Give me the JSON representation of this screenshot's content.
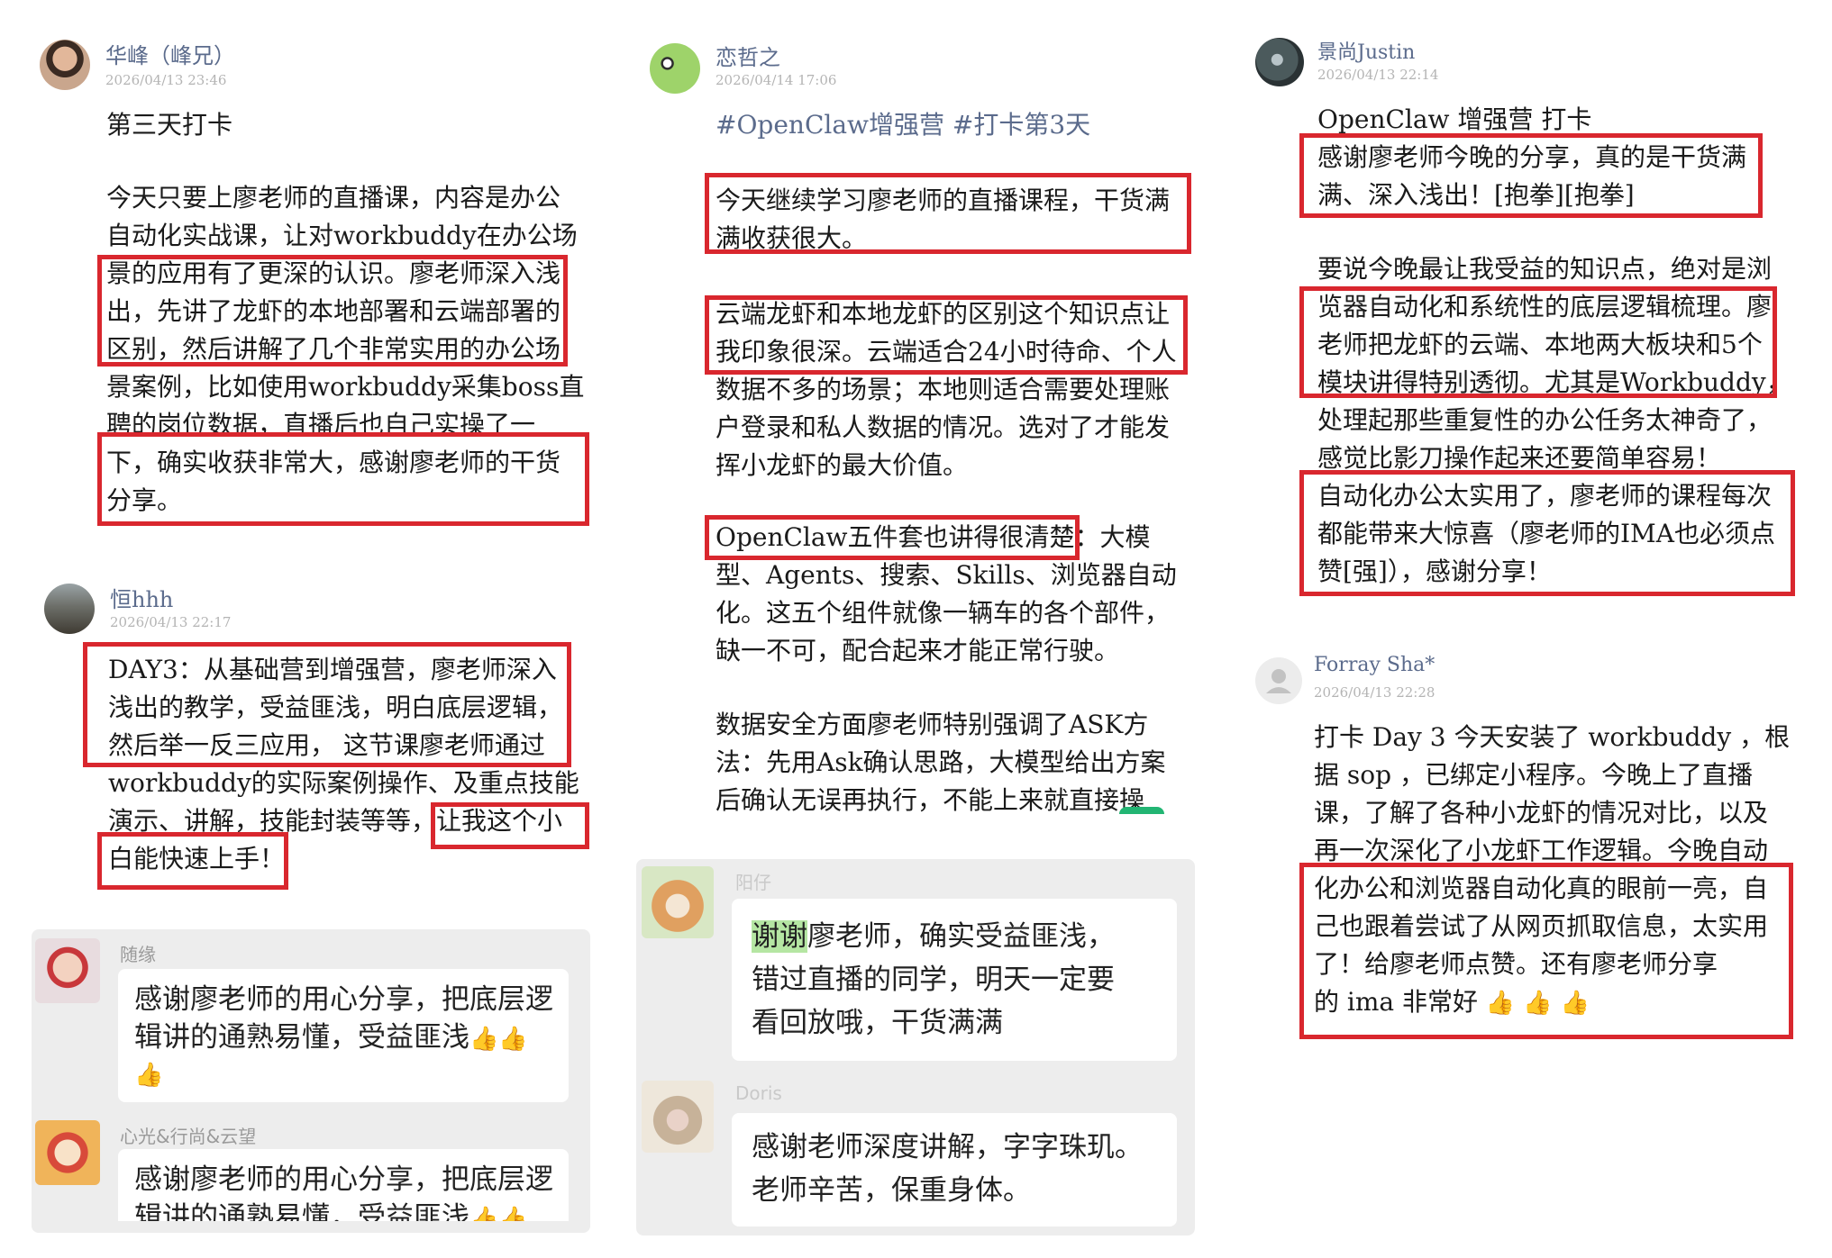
{
  "col1": {
    "post1": {
      "name": "华峰（峰兄）",
      "time": "2026/04/13 23:46",
      "lines": [
        "第三天打卡",
        "今天只要上廖老师的直播课，内容是办公",
        "自动化实战课，让对workbuddy在办公场",
        "景的应用有了更深的认识。廖老师深入浅",
        "出，先讲了龙虾的本地部署和云端部署的",
        "区别，然后讲解了几个非常实用的办公场",
        "景案例，比如使用workbuddy采集boss直",
        "聘的岗位数据，直播后也自己实操了一",
        "下，确实收获非常大，感谢廖老师的干货",
        "分享。"
      ]
    },
    "post2": {
      "name": "恒hhh",
      "time": "2026/04/13 22:17",
      "lines": [
        "DAY3：从基础营到增强营，廖老师深入",
        "浅出的教学，受益匪浅，明白底层逻辑，",
        "然后举一反三应用， 这节课廖老师通过",
        "workbuddy的实际案例操作、及重点技能",
        "演示、讲解，技能封装等等，让我这个小",
        "白能快速上手！"
      ]
    },
    "chat": [
      {
        "name": "随缘",
        "lines": [
          "感谢廖老师的用心分享，把底层逻",
          "辑讲的通熟易懂，受益匪浅"
        ]
      },
      {
        "name": "心光&行尚&云望",
        "lines": [
          "感谢廖老师的用心分享，把底层逻",
          "辑讲的通熟易懂，受益匪浅"
        ]
      }
    ]
  },
  "col2": {
    "post1": {
      "name": "恋哲之",
      "time": "2026/04/14 17:06",
      "hashtag": "#OpenClaw增强营 #打卡第3天",
      "lines": [
        "今天继续学习廖老师的直播课程，干货满",
        "满收获很大。",
        "云端龙虾和本地龙虾的区别这个知识点让",
        "我印象很深。云端适合24小时待命、个人",
        "数据不多的场景；本地则适合需要处理账",
        "户登录和私人数据的情况。选对了才能发",
        "挥小龙虾的最大价值。",
        "OpenClaw五件套也讲得很清楚：大模",
        "型、Agents、搜索、Skills、浏览器自动",
        "化。这五个组件就像一辆车的各个部件，",
        "缺一不可，配合起来才能正常行驶。",
        "数据安全方面廖老师特别强调了ASK方",
        "法：先用Ask确认思路，大模型给出方案",
        "后确认无误再执行，不能上来就直接操"
      ]
    },
    "chat": [
      {
        "name": "阳仔",
        "lines": [
          "谢谢廖老师，确实受益匪浅，",
          "错过直播的同学，明天一定要",
          "看回放哦，干货满满"
        ]
      },
      {
        "name": "Doris",
        "lines": [
          "感谢老师深度讲解，字字珠玑。",
          "老师辛苦，保重身体。"
        ]
      }
    ]
  },
  "col3": {
    "post1": {
      "name": "景尚Justin",
      "time": "2026/04/13 22:14",
      "lines": [
        "OpenClaw 增强营 打卡",
        "感谢廖老师今晚的分享，真的是干货满",
        "满、深入浅出！[抱拳][抱拳]",
        "要说今晚最让我受益的知识点，绝对是浏",
        "览器自动化和系统性的底层逻辑梳理。廖",
        "老师把龙虾的云端、本地两大板块和5个",
        "模块讲得特别透彻。尤其是Workbuddy，",
        "处理起那些重复性的办公任务太神奇了，",
        "感觉比影刀操作起来还要简单容易！",
        "自动化办公太实用了，廖老师的课程每次",
        "都能带来大惊喜（廖老师的IMA也必须点",
        "赞[强]），感谢分享！"
      ]
    },
    "post2": {
      "name": "Forray Sha*",
      "time": "2026/04/13 22:28",
      "lines": [
        "打卡 Day 3 今天安装了 workbuddy ，根",
        "据 sop ，已绑定小程序。今晚上了直播",
        "课，了解了各种小龙虾的情况对比，以及",
        "再一次深化了小龙虾工作逻辑。今晚自动",
        "化办公和浏览器自动化真的眼前一亮，自",
        "己也跟着尝试了从网页抓取信息，太实用",
        "了！给廖老师点赞。还有廖老师分享",
        "的 ima 非常好"
      ]
    }
  },
  "colors": {
    "highlight_box": "#d9272e",
    "name_color": "#5b6b8c",
    "chat_bg": "#ededed"
  },
  "icons": {
    "thumbs_up": "👍"
  }
}
